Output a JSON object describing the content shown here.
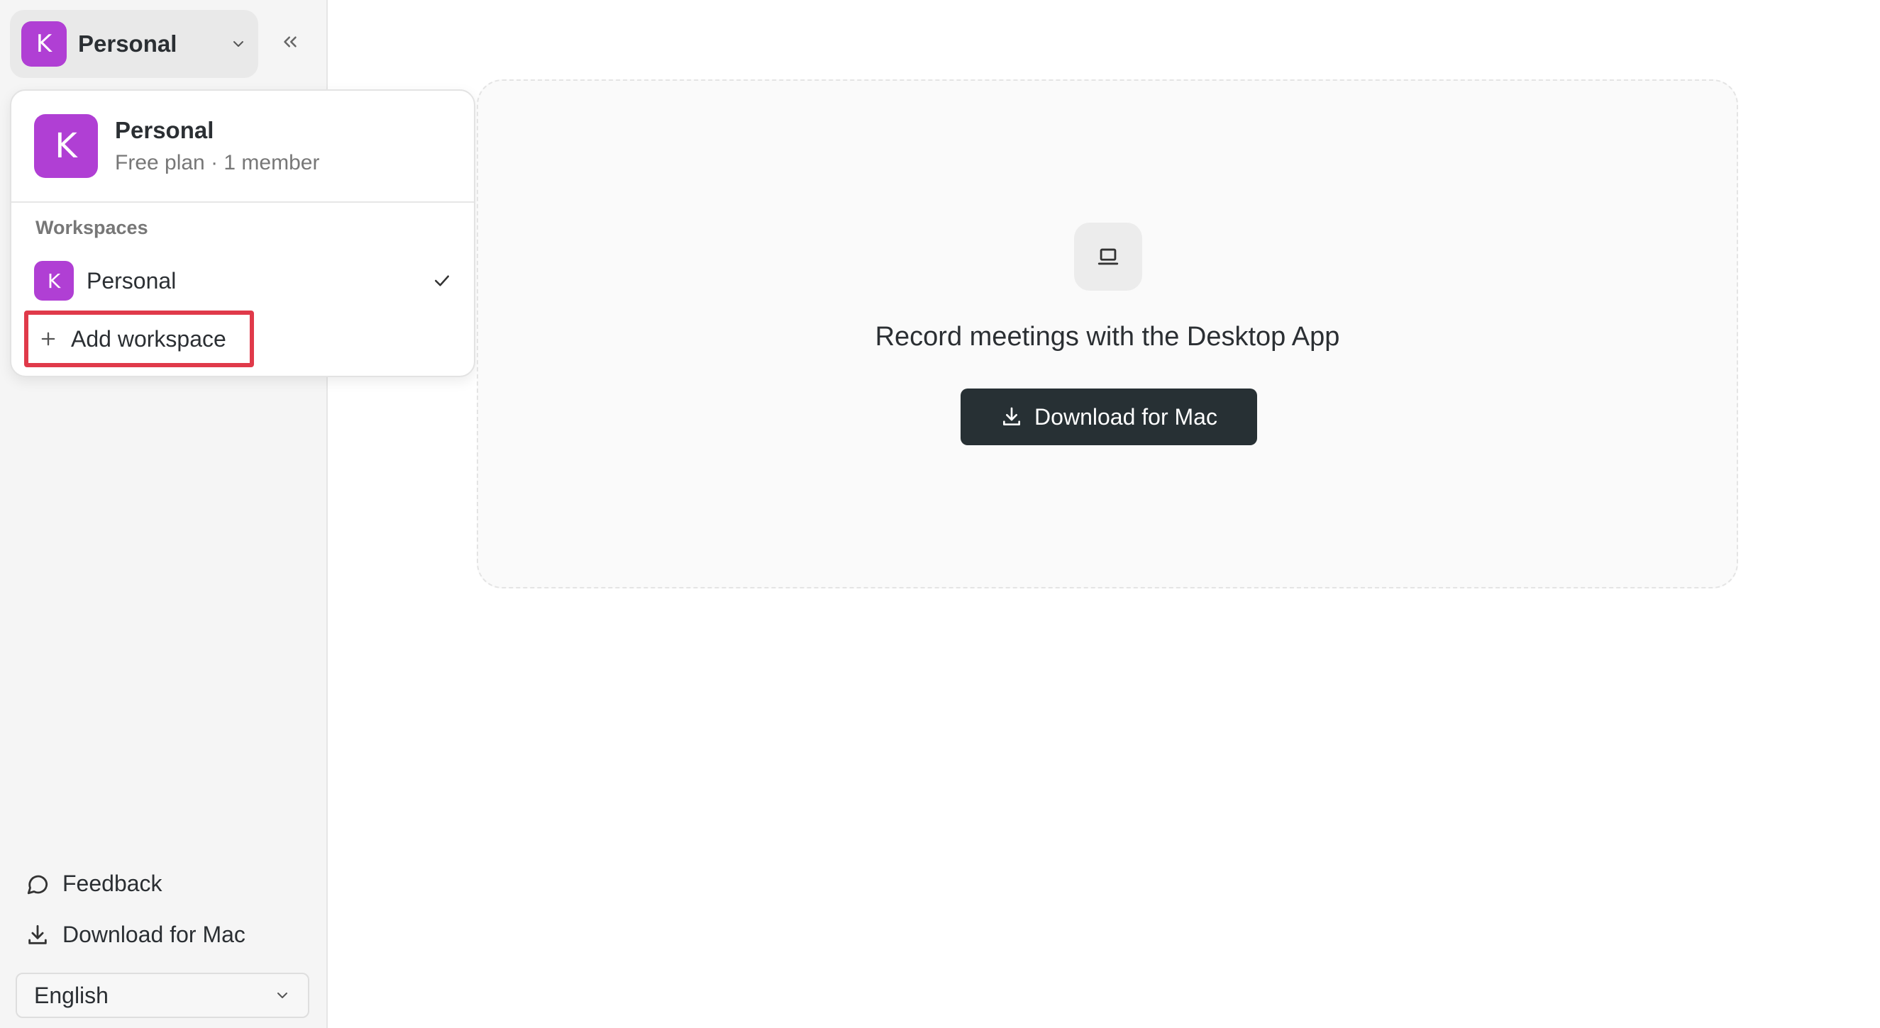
{
  "sidebar": {
    "workspace_initial": "K",
    "workspace_name": "Personal",
    "feedback_label": "Feedback",
    "download_label": "Download for Mac",
    "language": "English"
  },
  "dropdown": {
    "current": {
      "initial": "K",
      "name": "Personal",
      "subtitle": "Free plan · 1 member"
    },
    "section_label": "Workspaces",
    "items": [
      {
        "initial": "K",
        "name": "Personal",
        "selected": true
      }
    ],
    "add_label": "Add workspace"
  },
  "main": {
    "card_title": "Record meetings with the Desktop App",
    "download_button": "Download for Mac"
  },
  "colors": {
    "avatar": "#b03fd4",
    "primary_button": "#273034",
    "highlight_outline": "#e03a4a"
  },
  "icons": [
    "chevron-down-icon",
    "collapse-left-icon",
    "check-icon",
    "plus-icon",
    "laptop-icon",
    "download-icon",
    "chat-bubble-icon"
  ]
}
